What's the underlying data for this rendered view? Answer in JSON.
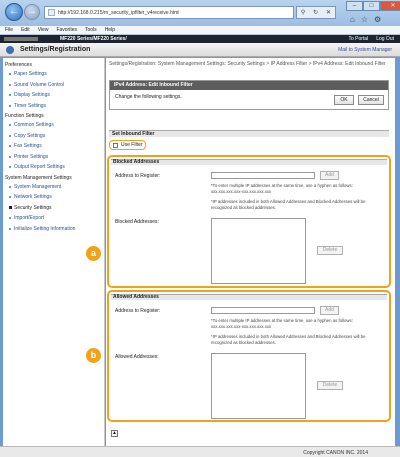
{
  "browser": {
    "url": "http://192.168.0.215/rn_security_ipfilter_v4receive.html",
    "menu": [
      "File",
      "Edit",
      "View",
      "Favorites",
      "Tools",
      "Help"
    ]
  },
  "header": {
    "model": "MF220 Series/MF220 Series/",
    "portal_link": "To Portal",
    "logout_link": "Log Out",
    "page_title": "Settings/Registration",
    "mail_link": "Mail to System Manager"
  },
  "sidebar": {
    "groups": [
      {
        "title": "Preferences",
        "items": [
          "Paper Settings",
          "Sound Volume Control",
          "Display Settings",
          "Timer Settings"
        ]
      },
      {
        "title": "Function Settings",
        "items": [
          "Common Settings",
          "Copy Settings",
          "Fax Settings",
          "Printer Settings",
          "Output Report Settings"
        ]
      },
      {
        "title": "System Management Settings",
        "items": [
          "System Management",
          "Network Settings",
          "Security Settings",
          "Import/Export",
          "Initialize Setting Information"
        ]
      }
    ],
    "active_item": "Security Settings"
  },
  "main": {
    "breadcrumb": "Settings/Registration: System Management Settings: Security Settings > IP Address Filter > IPv4 Address: Edit Inbound Filter",
    "box_title": "IPv4 Address: Edit Inbound Filter",
    "box_message": "Change the following settings.",
    "ok_label": "OK",
    "cancel_label": "Cancel",
    "section_title": "Set Inbound Filter",
    "use_filter_label": "Use Filter",
    "blocked": {
      "title": "Blocked Addresses",
      "register_label": "Address to Register:",
      "add_label": "Add",
      "note1": "*To enter multiple IP addresses at the same time, use a hyphen as follows: xxx.xxx.xxx.xxx-xxx.xxx.xxx.xxx",
      "note2": "*IP addresses included in both Allowed Addresses and Blocked Addresses will be recognized as blocked addresses.",
      "list_label": "Blocked Addresses:",
      "delete_label": "Delete",
      "badge": "a"
    },
    "allowed": {
      "title": "Allowed Addresses",
      "register_label": "Address to Register:",
      "add_label": "Add",
      "note1": "*To enter multiple IP addresses at the same time, use a hyphen as follows: xxx.xxx.xxx.xxx-xxx.xxx.xxx.xxx",
      "note2": "*IP addresses included in both Allowed Addresses and Blocked Addresses will be recognized as blocked addresses.",
      "list_label": "Allowed Addresses:",
      "delete_label": "Delete",
      "badge": "b"
    }
  },
  "footer": {
    "copyright": "Copyright CANON INC. 2014"
  },
  "colors": {
    "highlight": "#f0a31a",
    "header_bg": "#1e2330",
    "link": "#2a4f96"
  }
}
